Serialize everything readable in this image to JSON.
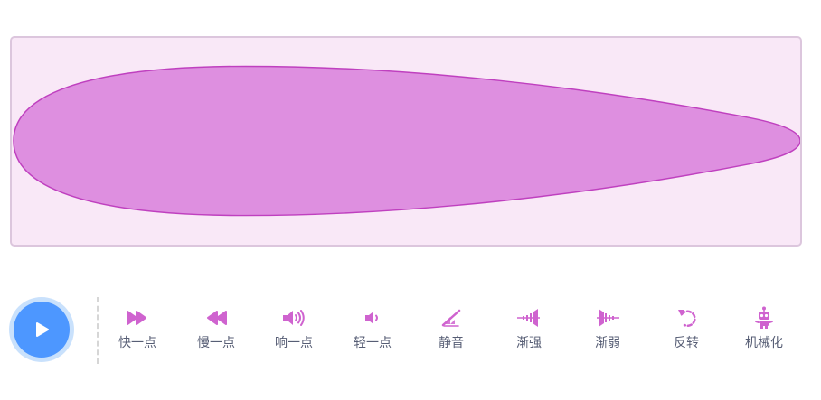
{
  "colors": {
    "accent": "#4d97ff",
    "accent_ring": "#c9e1fc",
    "effect_icon": "#cf63cf",
    "wave_fill": "#de8fe0",
    "wave_stroke": "#bf40bf",
    "panel_bg": "#f9e8f7",
    "panel_border": "#dcc6dd",
    "label": "#575e75"
  },
  "player": {
    "play_icon": "play-icon"
  },
  "effects": [
    {
      "icon": "faster-icon",
      "label": "快一点"
    },
    {
      "icon": "slower-icon",
      "label": "慢一点"
    },
    {
      "icon": "louder-icon",
      "label": "响一点"
    },
    {
      "icon": "softer-icon",
      "label": "轻一点"
    },
    {
      "icon": "mute-icon",
      "label": "静音"
    },
    {
      "icon": "fade-in-icon",
      "label": "渐强"
    },
    {
      "icon": "fade-out-icon",
      "label": "渐弱"
    },
    {
      "icon": "reverse-icon",
      "label": "反转"
    },
    {
      "icon": "robot-icon",
      "label": "机械化"
    }
  ]
}
